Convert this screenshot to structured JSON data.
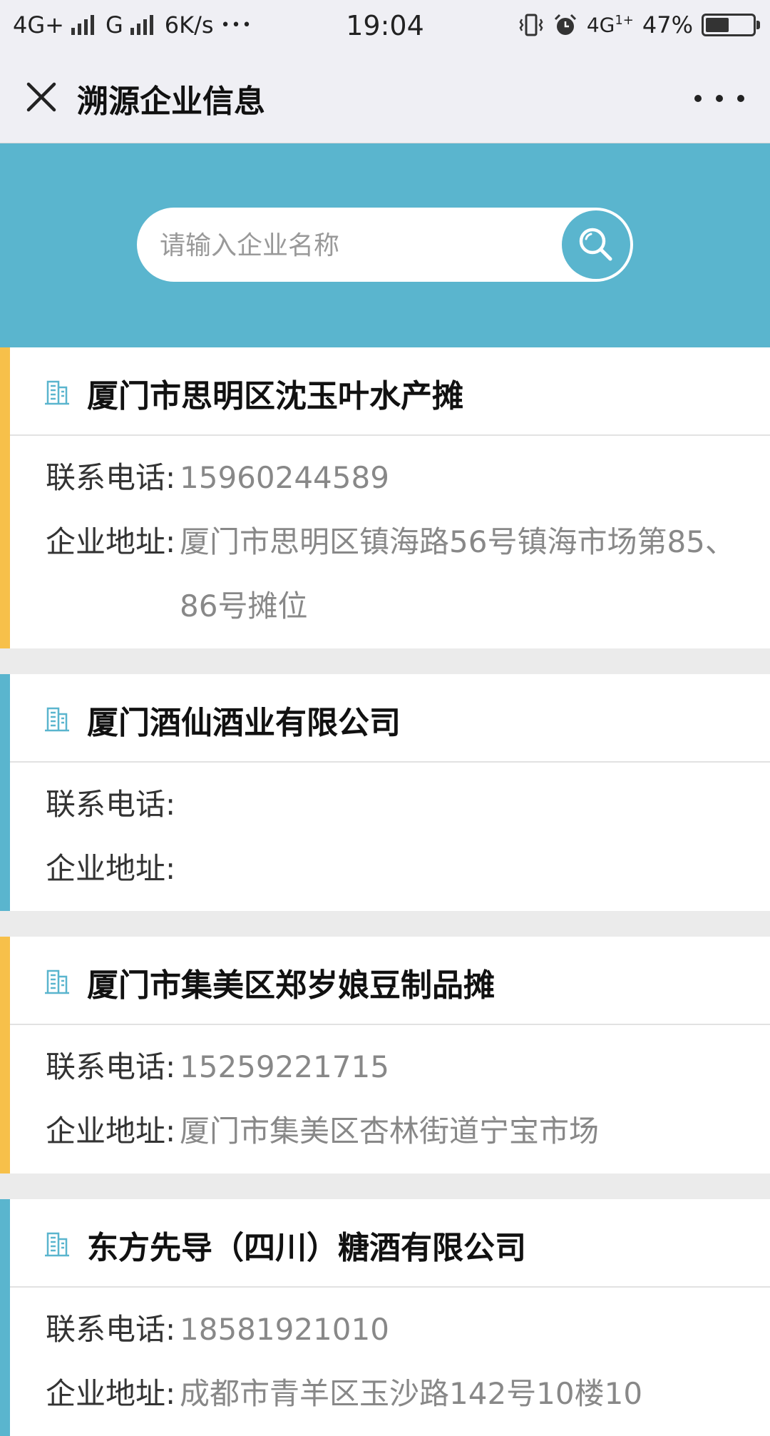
{
  "status_bar": {
    "network_left": "4G+",
    "network_g": "G",
    "speed": "6K/s",
    "more": "•••",
    "time": "19:04",
    "network_right": "4G",
    "battery": "47%"
  },
  "titlebar": {
    "title": "溯源企业信息"
  },
  "search": {
    "placeholder": "请输入企业名称"
  },
  "labels": {
    "phone": "联系电话:",
    "address": "企业地址:"
  },
  "colors": {
    "accent_teal": "#5ab5ce",
    "accent_yellow": "#f7c04a"
  },
  "companies": [
    {
      "name": "厦门市思明区沈玉叶水产摊",
      "phone": "15960244589",
      "address": "厦门市思明区镇海路56号镇海市场第85、86号摊位",
      "accent": "#f7c04a"
    },
    {
      "name": "厦门酒仙酒业有限公司",
      "phone": "",
      "address": "",
      "accent": "#5ab5ce"
    },
    {
      "name": "厦门市集美区郑岁娘豆制品摊",
      "phone": "15259221715",
      "address": "厦门市集美区杏林街道宁宝市场",
      "accent": "#f7c04a"
    },
    {
      "name": "东方先导（四川）糖酒有限公司",
      "phone": "18581921010",
      "address": "成都市青羊区玉沙路142号10楼10",
      "accent": "#5ab5ce"
    }
  ]
}
